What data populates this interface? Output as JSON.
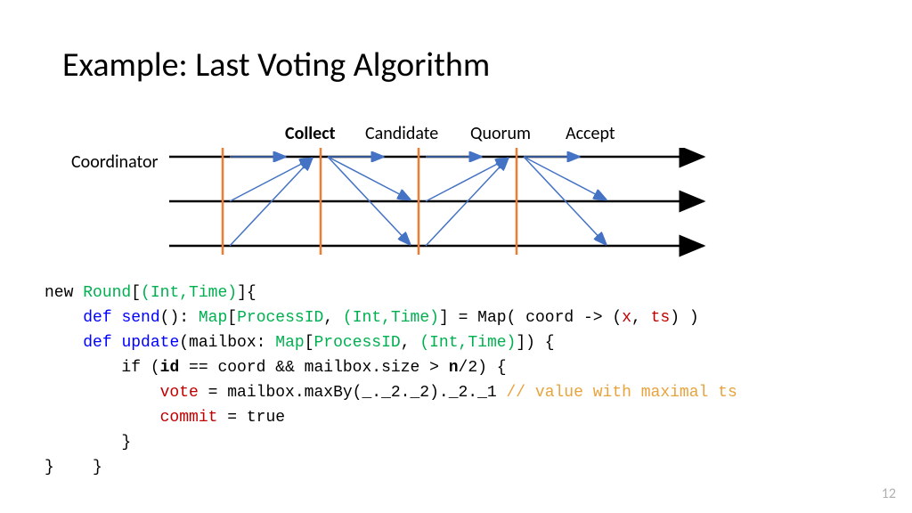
{
  "title": "Example: Last Voting Algorithm",
  "diagram": {
    "coordinator_label": "Coordinator",
    "phases": [
      {
        "label": "Collect",
        "bold": true
      },
      {
        "label": "Candidate",
        "bold": false
      },
      {
        "label": "Quorum",
        "bold": false
      },
      {
        "label": "Accept",
        "bold": false
      }
    ]
  },
  "code": {
    "new_kw": "new",
    "round_ty": "Round",
    "int_time": "(Int,Time)",
    "def_kw": "def",
    "send_fn": "send",
    "map_ty": "Map",
    "processid": "ProcessID",
    "coord_arrow": " = Map( coord -> (",
    "x_var": "x",
    "ts_var": "ts",
    "close_send": ") )",
    "update_fn": "update",
    "mailbox_param": "(mailbox: ",
    "close_update_sig": ") {",
    "if_kw": "if",
    "id_bold": "id",
    "n_bold": "n",
    "cond_mid": " == coord && mailbox.size > ",
    "cond_end": "/2) {",
    "vote_var": "vote",
    "vote_expr": " = mailbox.maxBy(_._2._2)._2._1 ",
    "comment": "// value with maximal ts",
    "commit_var": "commit",
    "commit_expr": " = true"
  },
  "page_number": "12"
}
